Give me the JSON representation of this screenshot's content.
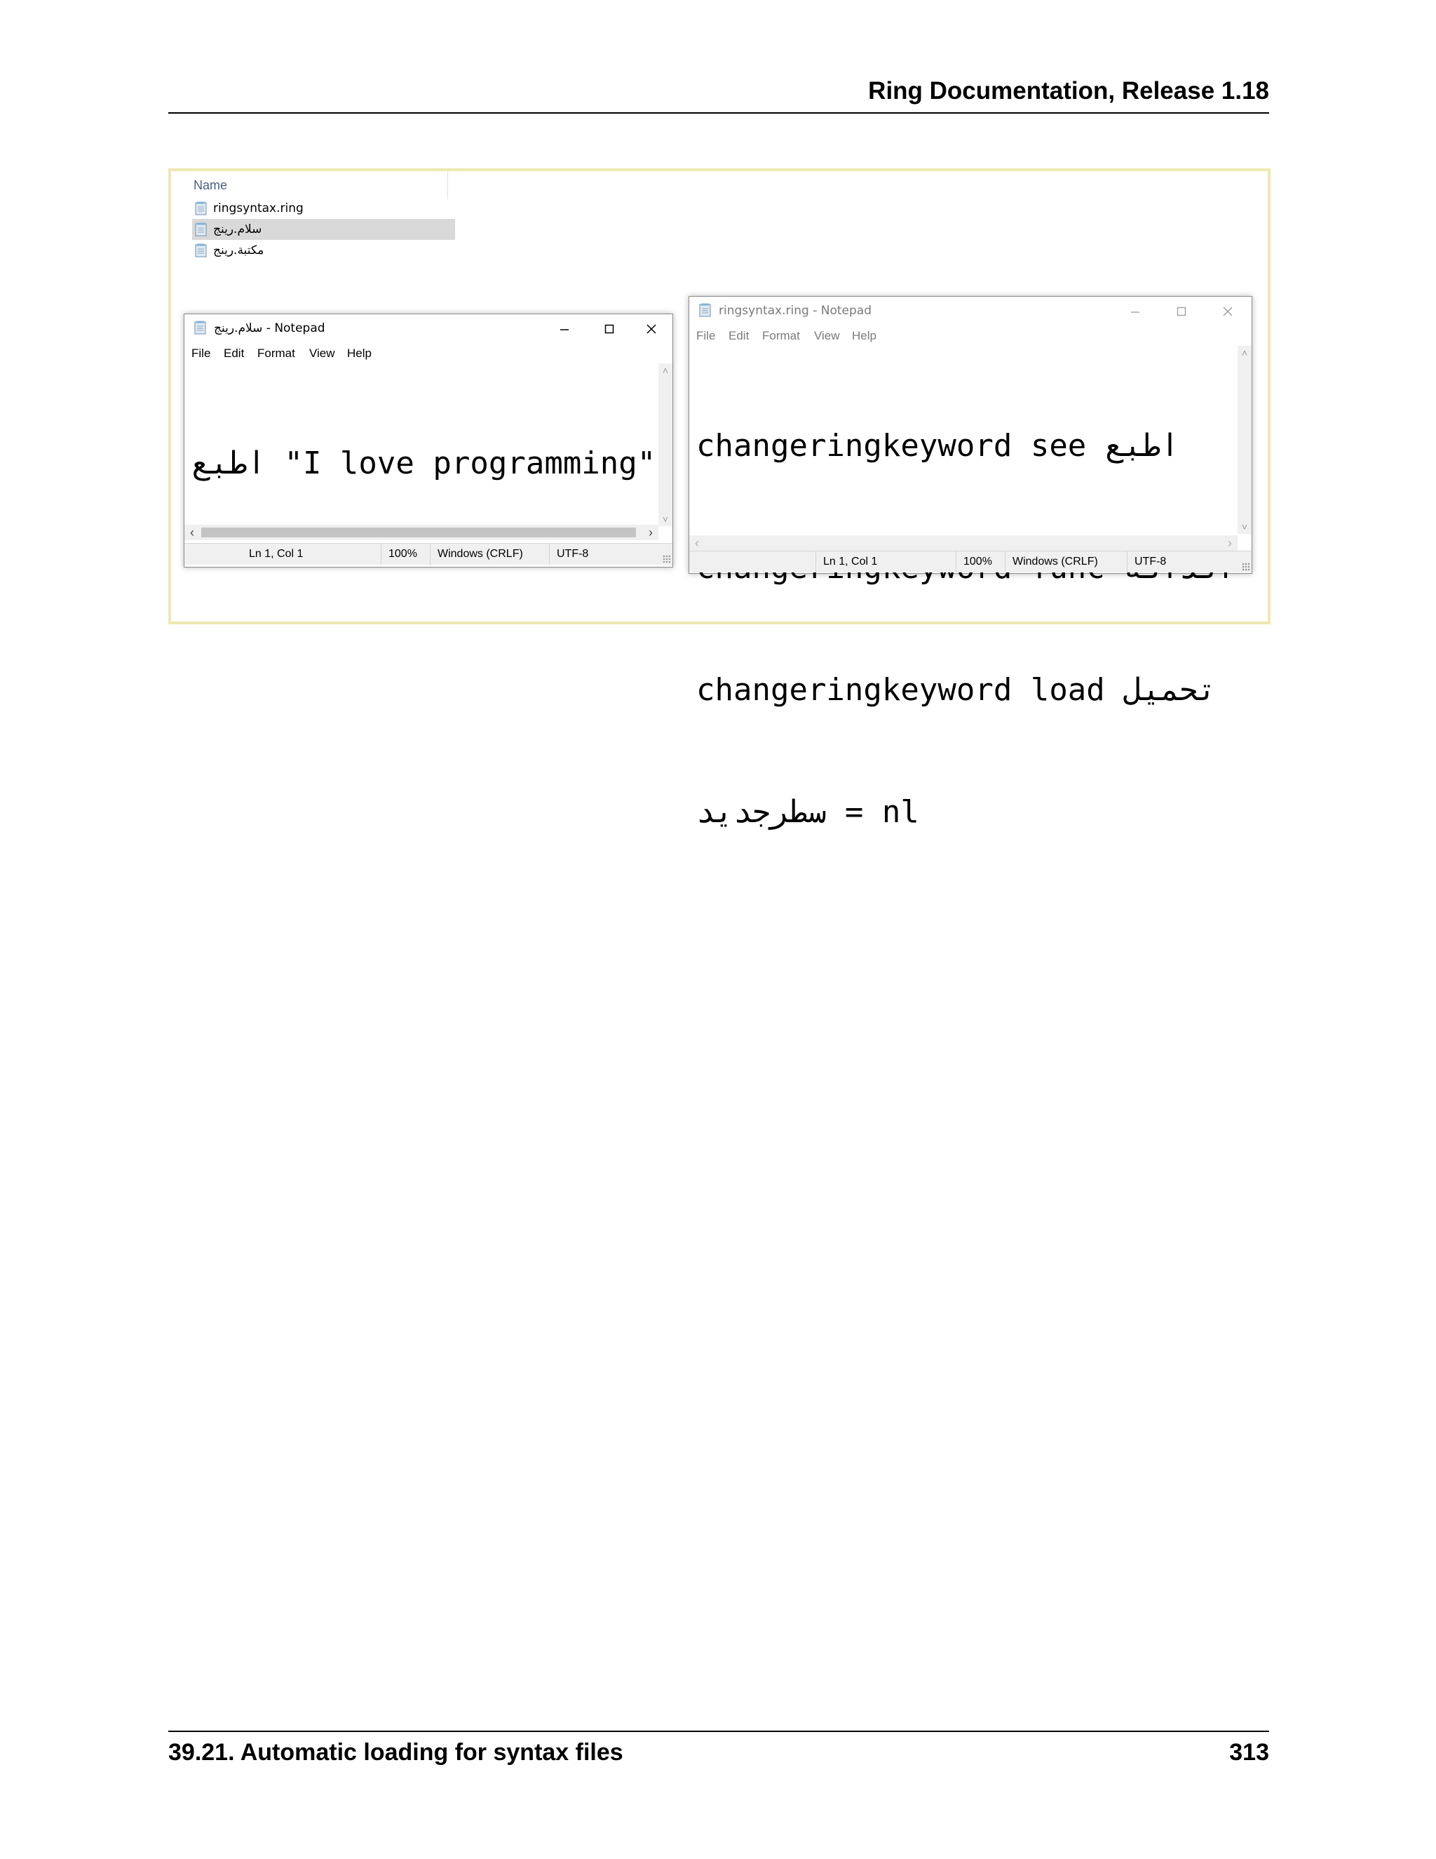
{
  "document": {
    "header_title": "Ring Documentation, Release 1.18",
    "footer_section": "39.21.  Automatic loading for syntax files",
    "footer_page": "313"
  },
  "explorer": {
    "column_header": "Name",
    "files": [
      {
        "name": "ringsyntax.ring",
        "selected": false
      },
      {
        "name": "سلام.رينج",
        "selected": true
      },
      {
        "name": "مكتبة.رينج",
        "selected": false
      }
    ]
  },
  "notepad_left": {
    "title": "سلام.رينج - Notepad",
    "menu": [
      "File",
      "Edit",
      "Format",
      "View",
      "Help"
    ],
    "content": [
      "اطبع \"I love programming\""
    ],
    "status": {
      "position": "Ln 1, Col 1",
      "zoom": "100%",
      "line_endings": "Windows (CRLF)",
      "encoding": "UTF-8"
    }
  },
  "notepad_right": {
    "title": "ringsyntax.ring - Notepad",
    "menu": [
      "File",
      "Edit",
      "Format",
      "View",
      "Help"
    ],
    "content": [
      "changeringkeyword see اطبع",
      "changeringkeyword func الدالة",
      "changeringkeyword load تحميل",
      "سطرجديد = nl"
    ],
    "status": {
      "position": "Ln 1, Col 1",
      "zoom": "100%",
      "line_endings": "Windows (CRLF)",
      "encoding": "UTF-8"
    }
  },
  "icons": {
    "file": "notepad-file-icon",
    "minimize": "minimize-icon",
    "maximize": "maximize-icon",
    "close": "close-icon"
  },
  "colors": {
    "figure_border": "#efe8b0",
    "selection": "#d9d9d9",
    "statusbar": "#f0f0f0"
  }
}
